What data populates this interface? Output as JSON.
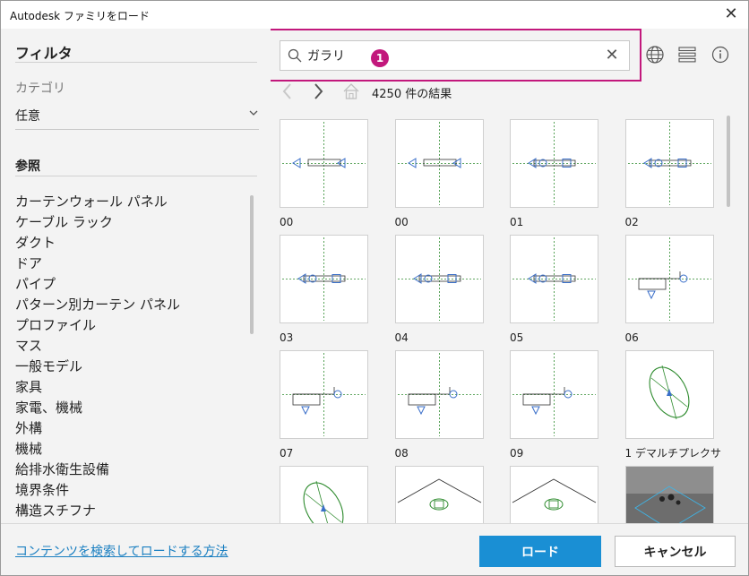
{
  "window": {
    "title": "Autodesk ファミリをロード",
    "close_glyph": "✕"
  },
  "sidebar": {
    "filter_title": "フィルタ",
    "category_label": "カテゴリ",
    "category_value": "任意",
    "reference_title": "参照",
    "items": [
      "カーテンウォール パネル",
      "ケーブル ラック",
      "ダクト",
      "ドア",
      "パイプ",
      "パターン別カーテン パネル",
      "プロファイル",
      "マス",
      "一般モデル",
      "家具",
      "家電、機械",
      "外構",
      "機械",
      "給排水衛生設備",
      "境界条件",
      "構造スチフナ"
    ]
  },
  "search": {
    "value": "ガラリ",
    "placeholder": "",
    "badge": "1",
    "clear_glyph": "✕"
  },
  "nav": {
    "result_count": "4250 件の結果"
  },
  "results": [
    {
      "label": "00",
      "thumb": "duct-symbol"
    },
    {
      "label": "00",
      "thumb": "duct-symbol"
    },
    {
      "label": "01",
      "thumb": "valve-symbol"
    },
    {
      "label": "02",
      "thumb": "valve-symbol"
    },
    {
      "label": "03",
      "thumb": "valve-symbol"
    },
    {
      "label": "04",
      "thumb": "valve-symbol"
    },
    {
      "label": "05",
      "thumb": "valve-symbol"
    },
    {
      "label": "06",
      "thumb": "elbow-symbol"
    },
    {
      "label": "07",
      "thumb": "elbow-symbol"
    },
    {
      "label": "08",
      "thumb": "elbow-symbol"
    },
    {
      "label": "09",
      "thumb": "elbow-symbol"
    },
    {
      "label": "1 デマルチプレクサ",
      "thumb": "ellipse-symbol"
    },
    {
      "label": "",
      "thumb": "ellipse-symbol"
    },
    {
      "label": "",
      "thumb": "roof-symbol"
    },
    {
      "label": "",
      "thumb": "roof-symbol"
    },
    {
      "label": "",
      "thumb": "photo-thumb"
    }
  ],
  "footer": {
    "help_link": "コンテンツを検索してロードする方法",
    "load_label": "ロード",
    "cancel_label": "キャンセル"
  },
  "colors": {
    "accent": "#1a8fd4",
    "highlight": "#c2187c",
    "link": "#1a7fc1",
    "guide_green": "#2e8b2e",
    "symbol_blue": "#3a6fc9"
  }
}
